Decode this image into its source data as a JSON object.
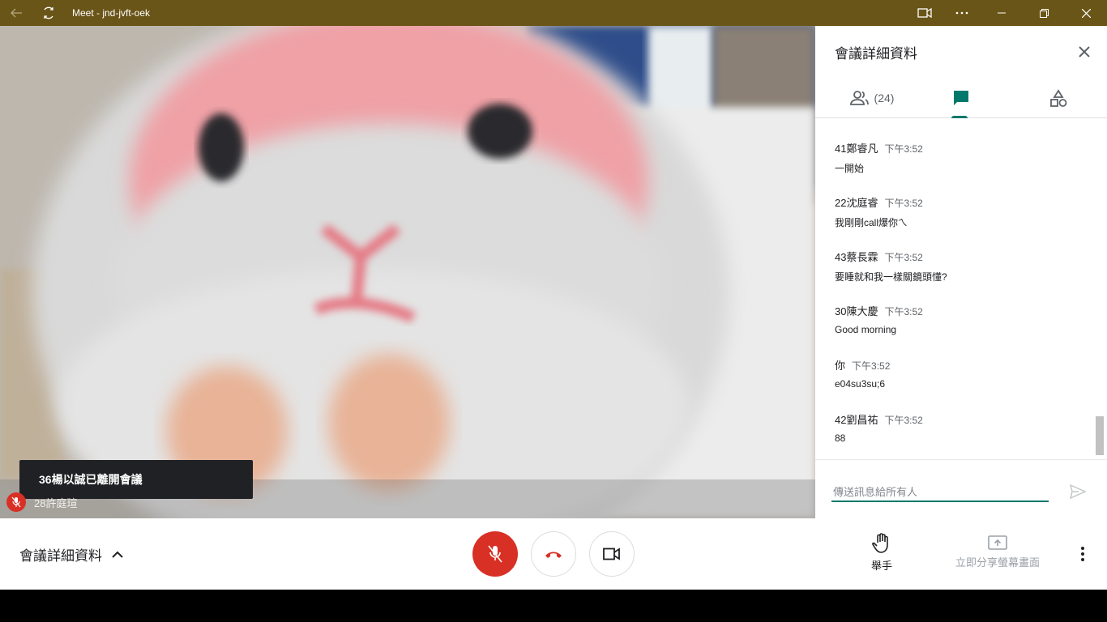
{
  "window": {
    "title": "Meet - jnd-jvft-oek"
  },
  "video": {
    "toast": "36楊以誠已離開會議",
    "participant_name": "28許庭瑄"
  },
  "panel": {
    "title": "會議詳細資料",
    "people_count": "(24)",
    "messages": [
      {
        "sender": "41鄭睿凡",
        "time": "下午3:52",
        "text": "一開始"
      },
      {
        "sender": "22沈庭睿",
        "time": "下午3:52",
        "text": "我剛剛call爆你ㄟ"
      },
      {
        "sender": "43蔡長霖",
        "time": "下午3:52",
        "text": "要睡就和我一樣關鏡頭懂?"
      },
      {
        "sender": "30陳大慶",
        "time": "下午3:52",
        "text": "Good morning"
      },
      {
        "sender": "你",
        "time": "下午3:52",
        "text": "e04su3su;6"
      },
      {
        "sender": "42劉昌祐",
        "time": "下午3:52",
        "text": "88"
      }
    ],
    "compose_placeholder": "傳送訊息給所有人"
  },
  "bottombar": {
    "details_label": "會議詳細資料",
    "raise_hand_label": "舉手",
    "present_label": "立即分享螢幕畫面"
  },
  "colors": {
    "titlebar": "#6a5518",
    "accent": "#00796b",
    "danger": "#d93025"
  }
}
